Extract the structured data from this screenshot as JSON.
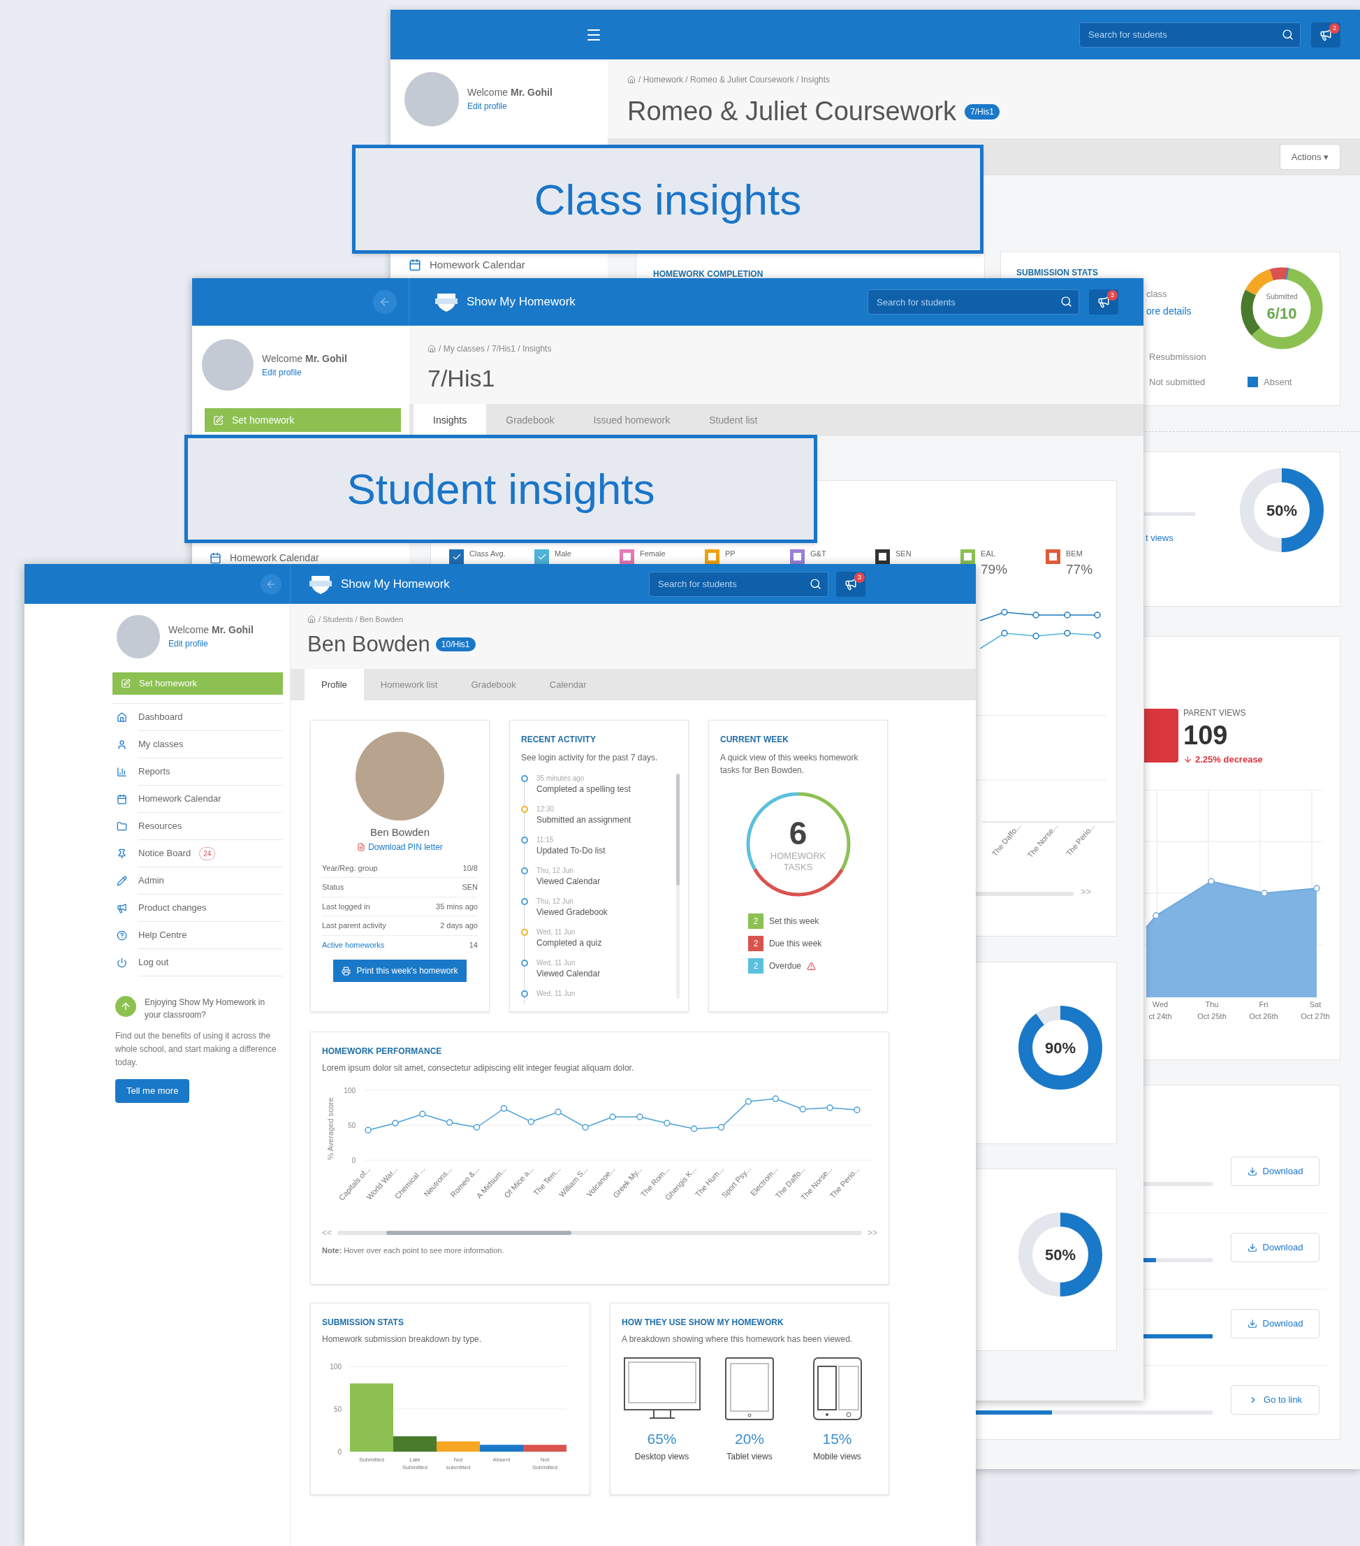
{
  "callouts": [
    {
      "text": "Class insights"
    },
    {
      "text": "Student insights"
    }
  ],
  "coursework_window": {
    "search": {
      "placeholder": "Search for students"
    },
    "notifications_badge": "2",
    "profile": {
      "welcome": "Welcome **Mr. Gohil**",
      "edit_link": "Edit profile"
    },
    "breadcrumb": "/ Homework / Romeo & Juliet Coursework / Insights",
    "title": "Romeo & Juliet Coursework",
    "title_badge": "7/His1",
    "actions_button": "Actions ▾",
    "sidebar_item": "Homework Calendar",
    "completion_card": {
      "title": "HOMEWORK COMPLETION"
    },
    "submission_card": {
      "title": "SUBMISSION STATS",
      "text": "class",
      "link": "ore details",
      "donut_label": "Submitted",
      "donut_value": "6/10",
      "legend": [
        {
          "label": "Resubmission"
        },
        {
          "label": "Not submitted"
        },
        {
          "label": "Absent",
          "color": "#1a78c8"
        }
      ]
    },
    "views_card": {
      "link": "t views",
      "reading": "50%",
      "level": 0.5
    },
    "parent_views_card": {
      "title": "PARENT VIEWS",
      "value": "109",
      "change": "2.25% decrease",
      "x_labels": [
        {
          "day": "Wed",
          "date": "ct 24th"
        },
        {
          "day": "Thu",
          "date": "Oct 25th"
        },
        {
          "day": "Fri",
          "date": "Oct 26th"
        },
        {
          "day": "Sat",
          "date": "Oct 27th"
        }
      ]
    },
    "resources_card": {
      "rows": [
        {
          "kind": "download",
          "button": "Download",
          "level": 0.5
        },
        {
          "kind": "download",
          "button": "Download",
          "level": 0.86
        },
        {
          "kind": "download",
          "button": "Download",
          "level": 1
        },
        {
          "kind": "link",
          "button": "Go to link",
          "level": 0.6
        }
      ]
    }
  },
  "class_window": {
    "app_name": "Show My Homework",
    "search": {
      "placeholder": "Search for students"
    },
    "notifications_badge": "3",
    "profile": {
      "welcome": "Welcome **Mr. Gohil**",
      "edit_link": "Edit profile"
    },
    "set_homework": "Set homework",
    "breadcrumb": "/ My classes / 7/His1 / Insights",
    "title": "7/His1",
    "tabs": [
      {
        "label": "Insights",
        "selected": true
      },
      {
        "label": "Gradebook",
        "selected": false
      },
      {
        "label": "Issued homework",
        "selected": false
      },
      {
        "label": "Student list",
        "selected": false
      }
    ],
    "sidebar_item": "Homework Calendar",
    "legend": [
      {
        "label": "Class Avg.",
        "color": "#1f6fb5",
        "checked": true
      },
      {
        "label": "Male",
        "color": "#4fb3d9",
        "checked": true
      },
      {
        "label": "Female",
        "color": "#e678b4",
        "checked": false
      },
      {
        "label": "PP",
        "color": "#f0a30a",
        "checked": false
      },
      {
        "label": "G&T",
        "color": "#9a7fd8",
        "checked": false
      },
      {
        "label": "SEN",
        "color": "#333333",
        "checked": false
      },
      {
        "label": "EAL",
        "color": "#8cc152",
        "checked": false,
        "value": "79%"
      },
      {
        "label": "BEM",
        "color": "#e05a3a",
        "checked": false,
        "value": "77%"
      }
    ],
    "chart_labels": [
      "The Daffo...",
      "The Norse...",
      "The Perio..."
    ],
    "scroll_forward": ">>",
    "donuts": [
      {
        "reading": "90%",
        "level": 0.9
      },
      {
        "reading": "50%",
        "level": 0.5
      }
    ]
  },
  "student_window": {
    "app_name": "Show My Homework",
    "search": {
      "placeholder": "Search for students"
    },
    "notifications_badge": "3",
    "profile": {
      "welcome": "Welcome **Mr. Gohil**",
      "edit_link": "Edit profile"
    },
    "set_homework": "Set homework",
    "nav": [
      {
        "label": "Dashboard"
      },
      {
        "label": "My classes"
      },
      {
        "label": "Reports"
      },
      {
        "label": "Homework Calendar"
      },
      {
        "label": "Resources"
      },
      {
        "label": "Notice Board",
        "badge": "24"
      },
      {
        "label": "Admin"
      },
      {
        "label": "Product changes"
      },
      {
        "label": "Help Centre"
      },
      {
        "label": "Log out"
      }
    ],
    "promo": {
      "title": "Enjoying Show My Homework in your classroom?",
      "text": "Find out the benefits of using it across the whole school, and start making a difference today.",
      "button": "Tell me more"
    },
    "breadcrumb": "/ Students / Ben Bowden",
    "title": "Ben Bowden",
    "title_badge": "10/His1",
    "tabs": [
      {
        "label": "Profile",
        "selected": true
      },
      {
        "label": "Homework list",
        "selected": false
      },
      {
        "label": "Gradebook",
        "selected": false
      },
      {
        "label": "Calendar",
        "selected": false
      }
    ],
    "profile_card": {
      "name": "Ben Bowden",
      "pin_link": "Download PIN letter",
      "rows": [
        {
          "label": "Year/Reg. group",
          "value": "10/8",
          "link": false
        },
        {
          "label": "Status",
          "value": "SEN",
          "link": false
        },
        {
          "label": "Last logged in",
          "value": "35 mins ago",
          "link": false
        },
        {
          "label": "Last parent activity",
          "value": "2 days ago",
          "link": false
        },
        {
          "label": "Active homeworks",
          "value": "14",
          "link": true
        }
      ],
      "print_button": "Print this week's homework"
    },
    "activity_card": {
      "title": "RECENT ACTIVITY",
      "subtitle": "See login activity for the past 7 days.",
      "items": [
        {
          "time": "35 minutes ago",
          "text": "Completed a spelling test",
          "color": "#4a9fd8"
        },
        {
          "time": "12:30",
          "text": "Submitted an assignment",
          "color": "#f0b429"
        },
        {
          "time": "11:15",
          "text": "Updated To-Do list",
          "color": "#4a9fd8"
        },
        {
          "time": "Thu, 12 Jun",
          "text": "Viewed Calendar",
          "color": "#4a9fd8"
        },
        {
          "time": "Thu, 12 Jun",
          "text": "Viewed Gradebook",
          "color": "#4a9fd8"
        },
        {
          "time": "Wed, 11 Jun",
          "text": "Completed a quiz",
          "color": "#f0b429"
        },
        {
          "time": "Wed, 11 Jun",
          "text": "Viewed Calendar",
          "color": "#4a9fd8"
        },
        {
          "time": "Wed, 11 Jun",
          "color": "#4a9fd8"
        }
      ]
    },
    "week_card": {
      "title": "CURRENT WEEK",
      "subtitle": "A quick view of this weeks homework tasks for Ben Bowden.",
      "total": "6",
      "total_label": "HOMEWORK TASKS",
      "items": [
        {
          "count": "2",
          "label": "Set this week",
          "color": "#8cc152",
          "warning": false
        },
        {
          "count": "2",
          "label": "Due this week",
          "color": "#d9534f",
          "warning": false
        },
        {
          "count": "2",
          "label": "Overdue",
          "color": "#5bc0de",
          "warning": true
        }
      ]
    },
    "performance_card": {
      "title": "HOMEWORK PERFORMANCE",
      "subtitle": "Lorem ipsum dolor sit amet, consectetur adipiscing elit integer feugiat aliquam dolor.",
      "note": "**Note:** Hover over each point to see more information.",
      "scroll_back": "<<",
      "scroll_forward": ">>",
      "chart_data": {
        "type": "line",
        "ylabel": "% Averaged score",
        "categories": [
          "Capitals of...",
          "World War...",
          "Chemical ...",
          "Neutrons...",
          "Romeo &...",
          "A Midsum...",
          "Of Mice a...",
          "The Tem...",
          "William S...",
          "Volcanoe...",
          "Greek My...",
          "The Rom...",
          "Ghengis K...",
          "The Hum...",
          "Sport Psy...",
          "Electrom...",
          "The Daffo...",
          "The Norse...",
          "The Perio..."
        ],
        "series": [
          {
            "color": "#4a9fd8",
            "marker": "circle",
            "values": [
              43,
              53,
              66,
              54,
              47,
              74,
              55,
              69,
              47,
              62,
              62,
              53,
              45,
              47,
              84,
              88,
              73,
              75,
              72
            ]
          }
        ],
        "ylim": [
          0,
          100
        ],
        "yticks": [
          0,
          50,
          100
        ]
      }
    },
    "submission_card": {
      "title": "SUBMISSION STATS",
      "subtitle": "Homework submission breakdown by type.",
      "chart_data": {
        "type": "bar",
        "categories": [
          "Submitted",
          "Late Submitted",
          "Not submitted",
          "Absent",
          "Not Submitted"
        ],
        "series": [
          {
            "color": "#8cc152",
            "values": [
              80,
              null,
              null,
              null,
              null
            ]
          },
          {
            "color": "#4a7a2c",
            "values": [
              null,
              18,
              null,
              null,
              null
            ]
          },
          {
            "color": "#f5a623",
            "values": [
              null,
              null,
              12,
              null,
              null
            ]
          },
          {
            "color": "#1a78c8",
            "values": [
              null,
              null,
              null,
              8,
              null
            ]
          },
          {
            "color": "#d9534f",
            "values": [
              null,
              null,
              null,
              null,
              8
            ]
          }
        ],
        "stacked": true,
        "ylim": [
          0,
          100
        ],
        "yticks": [
          0,
          50,
          100
        ]
      }
    },
    "devices_card": {
      "title": "HOW THEY USE SHOW MY HOMEWORK",
      "subtitle": "A breakdown showing where this homework has been viewed.",
      "devices": [
        {
          "kind": "desktop",
          "value": "65%",
          "label": "Desktop views"
        },
        {
          "kind": "tablet",
          "value": "20%",
          "label": "Tablet views"
        },
        {
          "kind": "mobile",
          "value": "15%",
          "label": "Mobile views"
        }
      ]
    }
  }
}
